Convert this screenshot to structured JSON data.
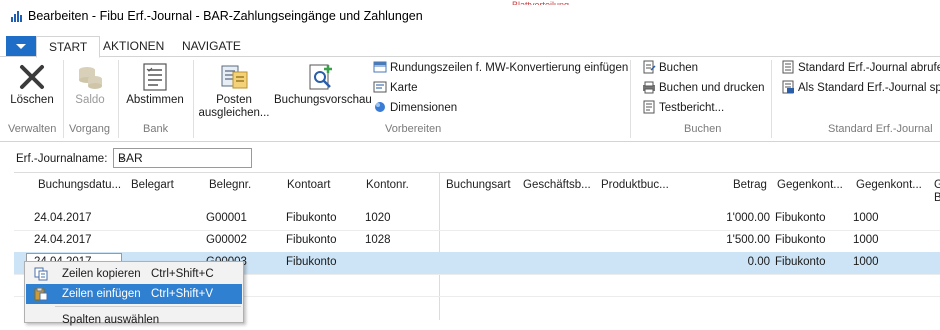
{
  "window": {
    "title": "Bearbeiten - Fibu Erf.-Journal - BAR-Zahlungseingänge und Zahlungen",
    "background_tab_hint": "Blattverteilung"
  },
  "ribbon": {
    "tabs": [
      {
        "label": "START",
        "active": true
      },
      {
        "label": "AKTIONEN",
        "active": false
      },
      {
        "label": "NAVIGATE",
        "active": false
      }
    ],
    "groups": {
      "verwalten": {
        "label": "Verwalten",
        "buttons": {
          "loeschen": "Löschen"
        }
      },
      "vorgang": {
        "label": "Vorgang",
        "buttons": {
          "saldo": "Saldo"
        }
      },
      "bank": {
        "label": "Bank",
        "buttons": {
          "abstimmen": "Abstimmen"
        }
      },
      "vorbereiten": {
        "label": "Vorbereiten",
        "buttons": {
          "posten_line1": "Posten",
          "posten_line2": "ausgleichen...",
          "buchungsvorschau": "Buchungsvorschau"
        },
        "small": [
          "Rundungszeilen f. MW-Konvertierung einfügen",
          "Karte",
          "Dimensionen"
        ]
      },
      "buchen": {
        "label": "Buchen",
        "small": [
          "Buchen",
          "Buchen und drucken",
          "Testbericht..."
        ]
      },
      "standard": {
        "label": "Standard Erf.-Journal",
        "small": [
          "Standard Erf.-Journal abrufen",
          "Als Standard Erf.-Journal speichern"
        ]
      }
    }
  },
  "journal": {
    "name_label": "Erf.-Journalname:",
    "name_value": "BAR"
  },
  "grid": {
    "headers": [
      "Buchungsdatu...",
      "Belegart",
      "Belegnr.",
      "Kontoart",
      "Kontonr.",
      "Buchungsart",
      "Geschäftsb...",
      "Produktbuc...",
      "Betrag",
      "Gegenkont...",
      "Gegenkont...",
      "G",
      "B"
    ],
    "rows": [
      {
        "date": "24.04.2017",
        "belegnr": "G00001",
        "kontoart": "Fibukonto",
        "kontonr": "1020",
        "betrag": "1'000.00",
        "gegenkontoart": "Fibukonto",
        "gegenkontonr": "1000"
      },
      {
        "date": "24.04.2017",
        "belegnr": "G00002",
        "kontoart": "Fibukonto",
        "kontonr": "1028",
        "betrag": "1'500.00",
        "gegenkontoart": "Fibukonto",
        "gegenkontonr": "1000"
      },
      {
        "date": "24.04.2017",
        "belegnr": "G00003",
        "kontoart": "Fibukonto",
        "kontonr": "",
        "betrag": "0.00",
        "gegenkontoart": "Fibukonto",
        "gegenkontonr": "1000"
      }
    ]
  },
  "context_menu": {
    "items": [
      {
        "label": "Zeilen kopieren",
        "shortcut": "Ctrl+Shift+C"
      },
      {
        "label": "Zeilen einfügen",
        "shortcut": "Ctrl+Shift+V"
      },
      {
        "label": "Spalten auswählen",
        "shortcut": ""
      }
    ]
  },
  "colors": {
    "accent": "#1e6ec8",
    "selection": "#cce4f6",
    "menu_highlight": "#2f80d1"
  }
}
